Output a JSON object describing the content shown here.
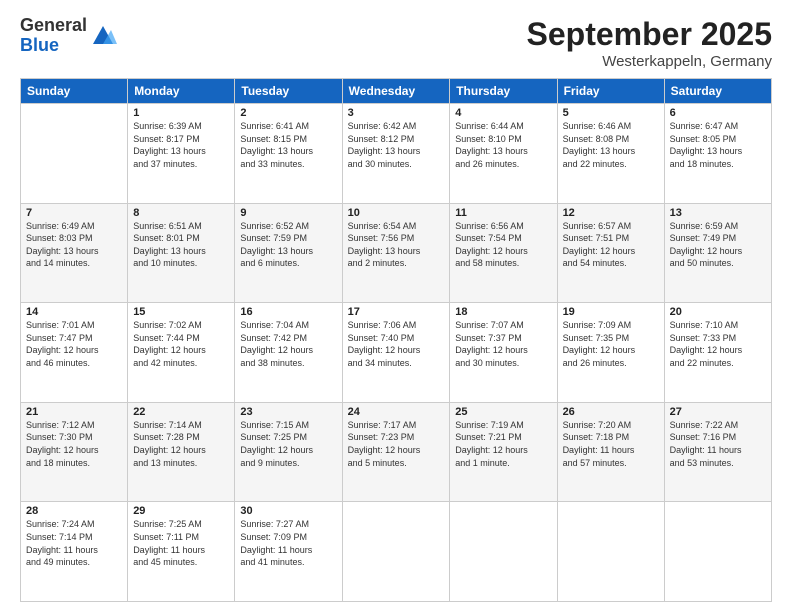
{
  "logo": {
    "general": "General",
    "blue": "Blue"
  },
  "title": "September 2025",
  "location": "Westerkappeln, Germany",
  "weekdays": [
    "Sunday",
    "Monday",
    "Tuesday",
    "Wednesday",
    "Thursday",
    "Friday",
    "Saturday"
  ],
  "weeks": [
    [
      {
        "day": "",
        "info": ""
      },
      {
        "day": "1",
        "info": "Sunrise: 6:39 AM\nSunset: 8:17 PM\nDaylight: 13 hours\nand 37 minutes."
      },
      {
        "day": "2",
        "info": "Sunrise: 6:41 AM\nSunset: 8:15 PM\nDaylight: 13 hours\nand 33 minutes."
      },
      {
        "day": "3",
        "info": "Sunrise: 6:42 AM\nSunset: 8:12 PM\nDaylight: 13 hours\nand 30 minutes."
      },
      {
        "day": "4",
        "info": "Sunrise: 6:44 AM\nSunset: 8:10 PM\nDaylight: 13 hours\nand 26 minutes."
      },
      {
        "day": "5",
        "info": "Sunrise: 6:46 AM\nSunset: 8:08 PM\nDaylight: 13 hours\nand 22 minutes."
      },
      {
        "day": "6",
        "info": "Sunrise: 6:47 AM\nSunset: 8:05 PM\nDaylight: 13 hours\nand 18 minutes."
      }
    ],
    [
      {
        "day": "7",
        "info": "Sunrise: 6:49 AM\nSunset: 8:03 PM\nDaylight: 13 hours\nand 14 minutes."
      },
      {
        "day": "8",
        "info": "Sunrise: 6:51 AM\nSunset: 8:01 PM\nDaylight: 13 hours\nand 10 minutes."
      },
      {
        "day": "9",
        "info": "Sunrise: 6:52 AM\nSunset: 7:59 PM\nDaylight: 13 hours\nand 6 minutes."
      },
      {
        "day": "10",
        "info": "Sunrise: 6:54 AM\nSunset: 7:56 PM\nDaylight: 13 hours\nand 2 minutes."
      },
      {
        "day": "11",
        "info": "Sunrise: 6:56 AM\nSunset: 7:54 PM\nDaylight: 12 hours\nand 58 minutes."
      },
      {
        "day": "12",
        "info": "Sunrise: 6:57 AM\nSunset: 7:51 PM\nDaylight: 12 hours\nand 54 minutes."
      },
      {
        "day": "13",
        "info": "Sunrise: 6:59 AM\nSunset: 7:49 PM\nDaylight: 12 hours\nand 50 minutes."
      }
    ],
    [
      {
        "day": "14",
        "info": "Sunrise: 7:01 AM\nSunset: 7:47 PM\nDaylight: 12 hours\nand 46 minutes."
      },
      {
        "day": "15",
        "info": "Sunrise: 7:02 AM\nSunset: 7:44 PM\nDaylight: 12 hours\nand 42 minutes."
      },
      {
        "day": "16",
        "info": "Sunrise: 7:04 AM\nSunset: 7:42 PM\nDaylight: 12 hours\nand 38 minutes."
      },
      {
        "day": "17",
        "info": "Sunrise: 7:06 AM\nSunset: 7:40 PM\nDaylight: 12 hours\nand 34 minutes."
      },
      {
        "day": "18",
        "info": "Sunrise: 7:07 AM\nSunset: 7:37 PM\nDaylight: 12 hours\nand 30 minutes."
      },
      {
        "day": "19",
        "info": "Sunrise: 7:09 AM\nSunset: 7:35 PM\nDaylight: 12 hours\nand 26 minutes."
      },
      {
        "day": "20",
        "info": "Sunrise: 7:10 AM\nSunset: 7:33 PM\nDaylight: 12 hours\nand 22 minutes."
      }
    ],
    [
      {
        "day": "21",
        "info": "Sunrise: 7:12 AM\nSunset: 7:30 PM\nDaylight: 12 hours\nand 18 minutes."
      },
      {
        "day": "22",
        "info": "Sunrise: 7:14 AM\nSunset: 7:28 PM\nDaylight: 12 hours\nand 13 minutes."
      },
      {
        "day": "23",
        "info": "Sunrise: 7:15 AM\nSunset: 7:25 PM\nDaylight: 12 hours\nand 9 minutes."
      },
      {
        "day": "24",
        "info": "Sunrise: 7:17 AM\nSunset: 7:23 PM\nDaylight: 12 hours\nand 5 minutes."
      },
      {
        "day": "25",
        "info": "Sunrise: 7:19 AM\nSunset: 7:21 PM\nDaylight: 12 hours\nand 1 minute."
      },
      {
        "day": "26",
        "info": "Sunrise: 7:20 AM\nSunset: 7:18 PM\nDaylight: 11 hours\nand 57 minutes."
      },
      {
        "day": "27",
        "info": "Sunrise: 7:22 AM\nSunset: 7:16 PM\nDaylight: 11 hours\nand 53 minutes."
      }
    ],
    [
      {
        "day": "28",
        "info": "Sunrise: 7:24 AM\nSunset: 7:14 PM\nDaylight: 11 hours\nand 49 minutes."
      },
      {
        "day": "29",
        "info": "Sunrise: 7:25 AM\nSunset: 7:11 PM\nDaylight: 11 hours\nand 45 minutes."
      },
      {
        "day": "30",
        "info": "Sunrise: 7:27 AM\nSunset: 7:09 PM\nDaylight: 11 hours\nand 41 minutes."
      },
      {
        "day": "",
        "info": ""
      },
      {
        "day": "",
        "info": ""
      },
      {
        "day": "",
        "info": ""
      },
      {
        "day": "",
        "info": ""
      }
    ]
  ]
}
